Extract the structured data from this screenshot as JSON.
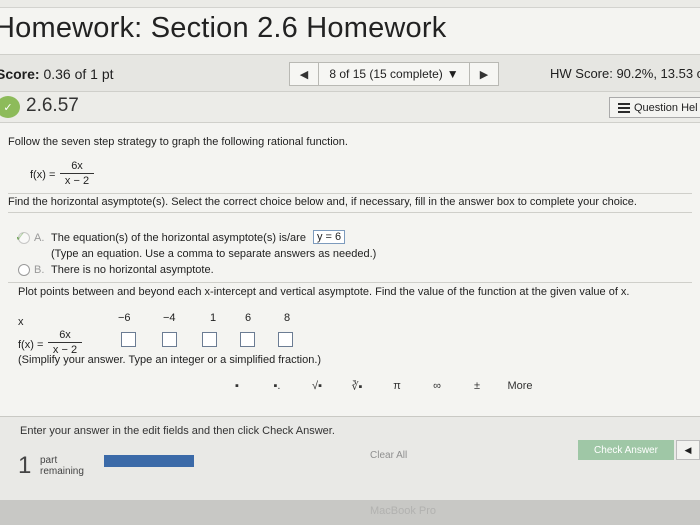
{
  "header": {
    "title": "Homework: Section 2.6 Homework"
  },
  "score_bar": {
    "score_label": "Score:",
    "score_value": "0.36 of 1 pt",
    "nav_prev": "◀",
    "nav_label": "8 of 15 (15 complete)",
    "nav_dropdown": "▼",
    "nav_next": "▶",
    "hw_score": "HW Score: 90.2%, 13.53 o"
  },
  "question_bar": {
    "id": "2.6.57",
    "help_label": "Question Hel"
  },
  "question": {
    "instruction": "Follow the seven step strategy to graph the following rational function.",
    "fx": "f(x) =",
    "num": "6x",
    "den": "x − 2",
    "prompt1": "Find the horizontal asymptote(s). Select the correct choice below and, if necessary, fill in the answer box to complete your choice.",
    "optA_letter": "A.",
    "optA_text": "The equation(s) of the horizontal asymptote(s) is/are",
    "optA_answer": "y = 6",
    "optA_note": "(Type an equation. Use a comma to separate answers as needed.)",
    "optB_letter": "B.",
    "optB_text": "There is no horizontal asymptote.",
    "prompt2": "Plot points between and beyond each x-intercept and vertical asymptote. Find the value of the function at the given value of x.",
    "x_label": "x",
    "x_values": [
      "−6",
      "−4",
      "1",
      "6",
      "8"
    ],
    "fx2": "f(x) =",
    "num2": "6x",
    "den2": "x − 2",
    "simplify_note": "(Simplify your answer. Type an integer or a simplified fraction.)"
  },
  "toolbar": {
    "tools": [
      "▪",
      "▪.",
      "√▪",
      "∛▪",
      "π",
      "∞",
      "±"
    ],
    "more": "More"
  },
  "footer": {
    "message": "Enter your answer in the edit fields and then click Check Answer.",
    "part_number": "1",
    "part_label_1": "part",
    "part_label_2": "remaining",
    "clear_all": "Clear All",
    "check_answer": "Check Answer",
    "back": "◀"
  },
  "bezel": {
    "brand": "MacBook Pro"
  },
  "colors": {
    "accent_blue": "#3b6aa8",
    "check_green": "#9fc7a6",
    "correct_green": "#6aa84f"
  }
}
